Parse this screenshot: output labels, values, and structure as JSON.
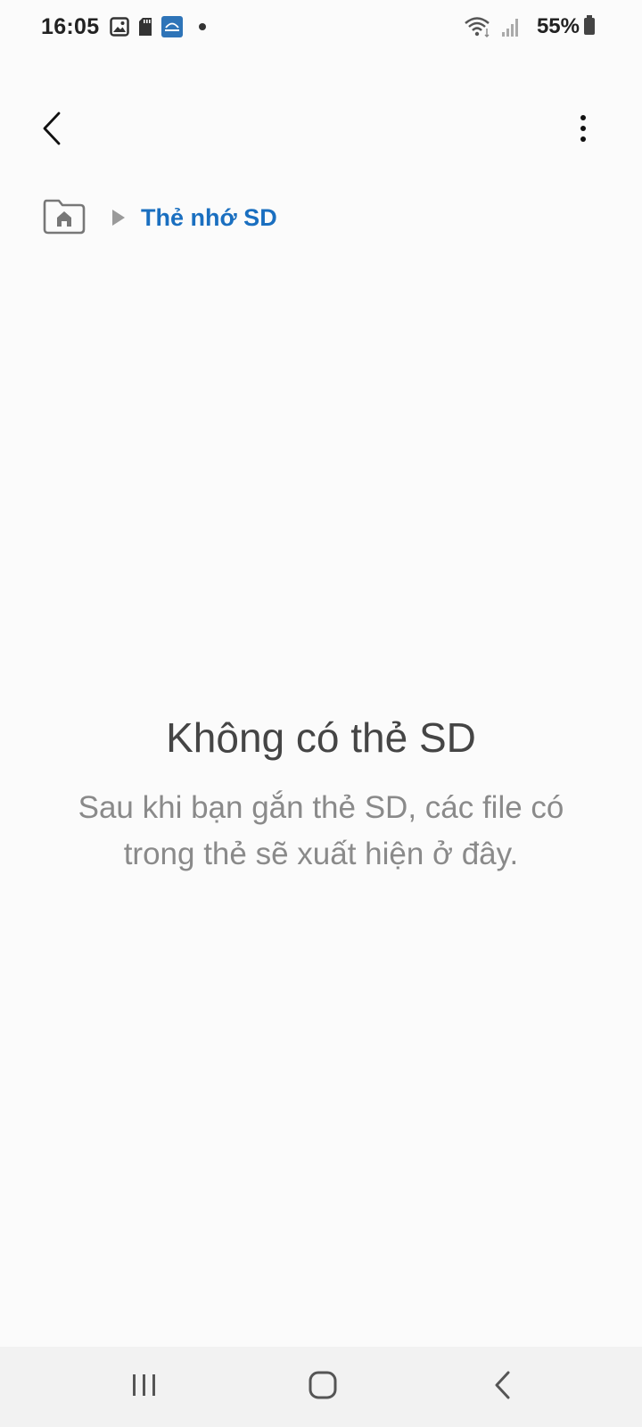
{
  "status_bar": {
    "time": "16:05",
    "left_icons": [
      "gallery-icon",
      "sd-card-icon",
      "app-notification-icon",
      "dot-icon"
    ],
    "right_icons": [
      "wifi-icon",
      "signal-icon",
      "battery-icon"
    ],
    "battery_percent": "55%"
  },
  "app_bar": {
    "back_icon": "chevron-left-icon",
    "more_icon": "more-vertical-icon"
  },
  "breadcrumb": {
    "home_icon": "home-folder-icon",
    "separator_icon": "triangle-right-icon",
    "current": "Thẻ nhớ SD",
    "accent_color": "#1a6fc0"
  },
  "empty_state": {
    "title": "Không có thẻ SD",
    "message": "Sau khi bạn gắn thẻ SD, các file có trong thẻ sẽ xuất hiện ở đây."
  },
  "nav_bar": {
    "recents_icon": "recents-icon",
    "home_icon": "home-icon",
    "back_icon": "back-icon"
  }
}
